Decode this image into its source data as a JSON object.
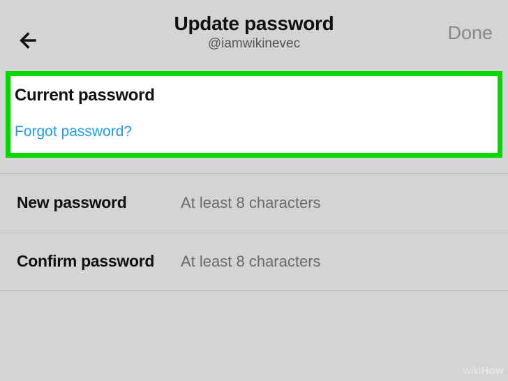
{
  "header": {
    "title": "Update password",
    "handle": "@iamwikinevec",
    "done_label": "Done"
  },
  "current": {
    "label": "Current password",
    "forgot_link": "Forgot password?"
  },
  "new_password": {
    "label": "New password",
    "placeholder": "At least 8 characters"
  },
  "confirm_password": {
    "label": "Confirm password",
    "placeholder": "At least 8 characters"
  },
  "watermark": {
    "wiki": "wiki",
    "how": "How"
  }
}
